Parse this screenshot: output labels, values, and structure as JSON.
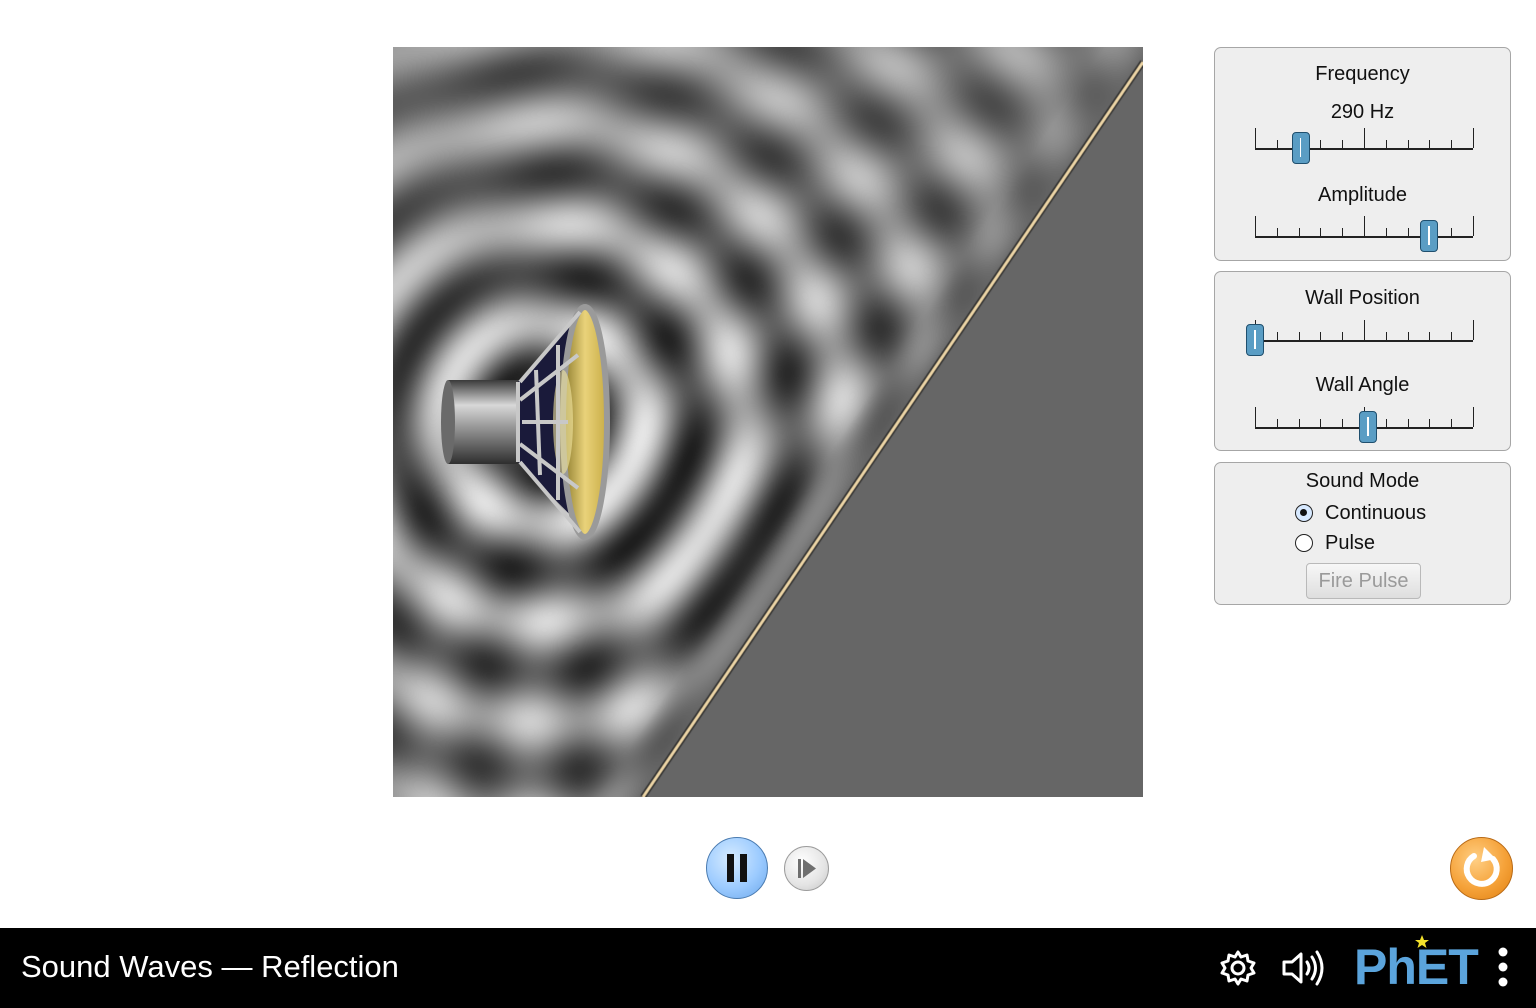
{
  "controls": {
    "frequency": {
      "label": "Frequency",
      "value_text": "290 Hz",
      "value": 290,
      "fraction": 0.21
    },
    "amplitude": {
      "label": "Amplitude",
      "fraction": 0.8
    },
    "wall_position": {
      "label": "Wall Position",
      "fraction": 0.0
    },
    "wall_angle": {
      "label": "Wall Angle",
      "fraction": 0.52
    },
    "sound_mode": {
      "label": "Sound Mode",
      "options": [
        "Continuous",
        "Pulse"
      ],
      "selected": "Continuous",
      "fire_pulse_label": "Fire Pulse",
      "fire_pulse_enabled": false
    }
  },
  "playback": {
    "playing": true,
    "play_pause_icon": "pause-icon",
    "step_icon": "step-forward-icon"
  },
  "reset": {
    "icon": "reset-icon"
  },
  "nav": {
    "title": "Sound Waves — Reflection",
    "icons": [
      "settings-gear-icon",
      "audio-icon",
      "phet-logo",
      "kebab-menu-icon"
    ],
    "logo_text": "PhET"
  },
  "colors": {
    "accent": "#5ba4dc",
    "slider_thumb": "#5a9dc4",
    "wall": "#666666",
    "wall_edge": "#f0d8a8",
    "reset": "#f5a239",
    "play": "#9ccbff"
  }
}
